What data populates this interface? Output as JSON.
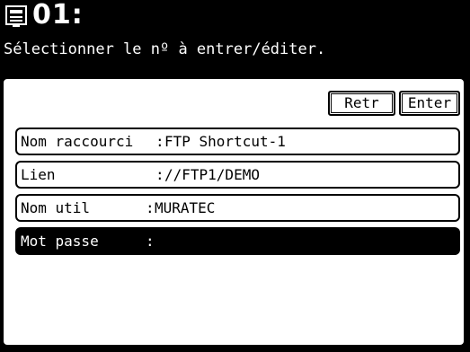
{
  "header": {
    "icon": "phonebook-icon",
    "number": "01:",
    "instruction": "Sélectionner le nº à entrer/éditer."
  },
  "buttons": {
    "retr": "Retr",
    "enter": "Enter"
  },
  "fields": [
    {
      "label": "Nom raccourci",
      "separator": ":",
      "value": "FTP Shortcut-1",
      "selected": false
    },
    {
      "label": "Lien",
      "separator": ":",
      "value": "//FTP1/DEMO",
      "selected": false
    },
    {
      "label": "Nom util",
      "separator": ":",
      "value": "MURATEC",
      "selected": false
    },
    {
      "label": "Mot passe",
      "separator": ":",
      "value": "",
      "selected": true
    }
  ],
  "colors": {
    "background": "#000000",
    "panel": "#ffffff",
    "selected_row": "#000000"
  }
}
